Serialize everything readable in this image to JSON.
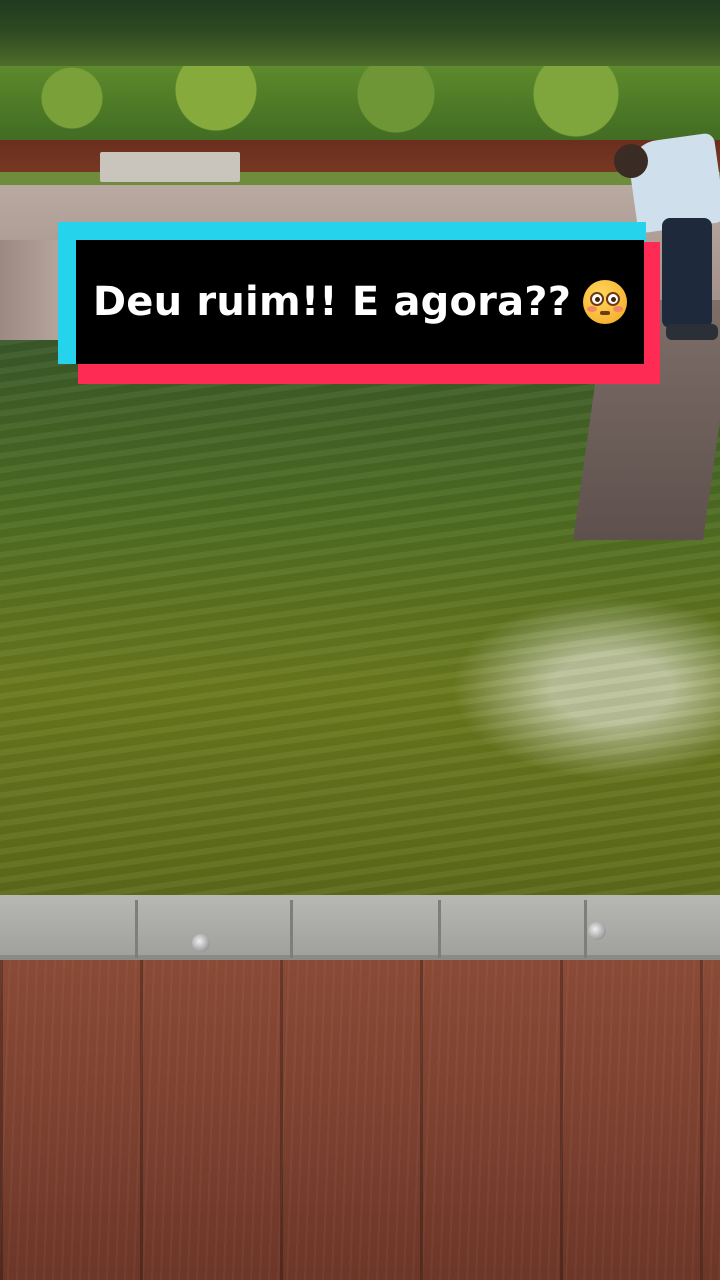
{
  "caption": {
    "text": "Deu ruim!! E agora??",
    "emoji": "flushed-face-emoji",
    "colors": {
      "box_bg": "#000000",
      "text": "#ffffff",
      "cyan_shadow": "#25d4ec",
      "red_shadow": "#fe2c55"
    }
  },
  "scene": {
    "subject": "pool-with-green-water"
  }
}
